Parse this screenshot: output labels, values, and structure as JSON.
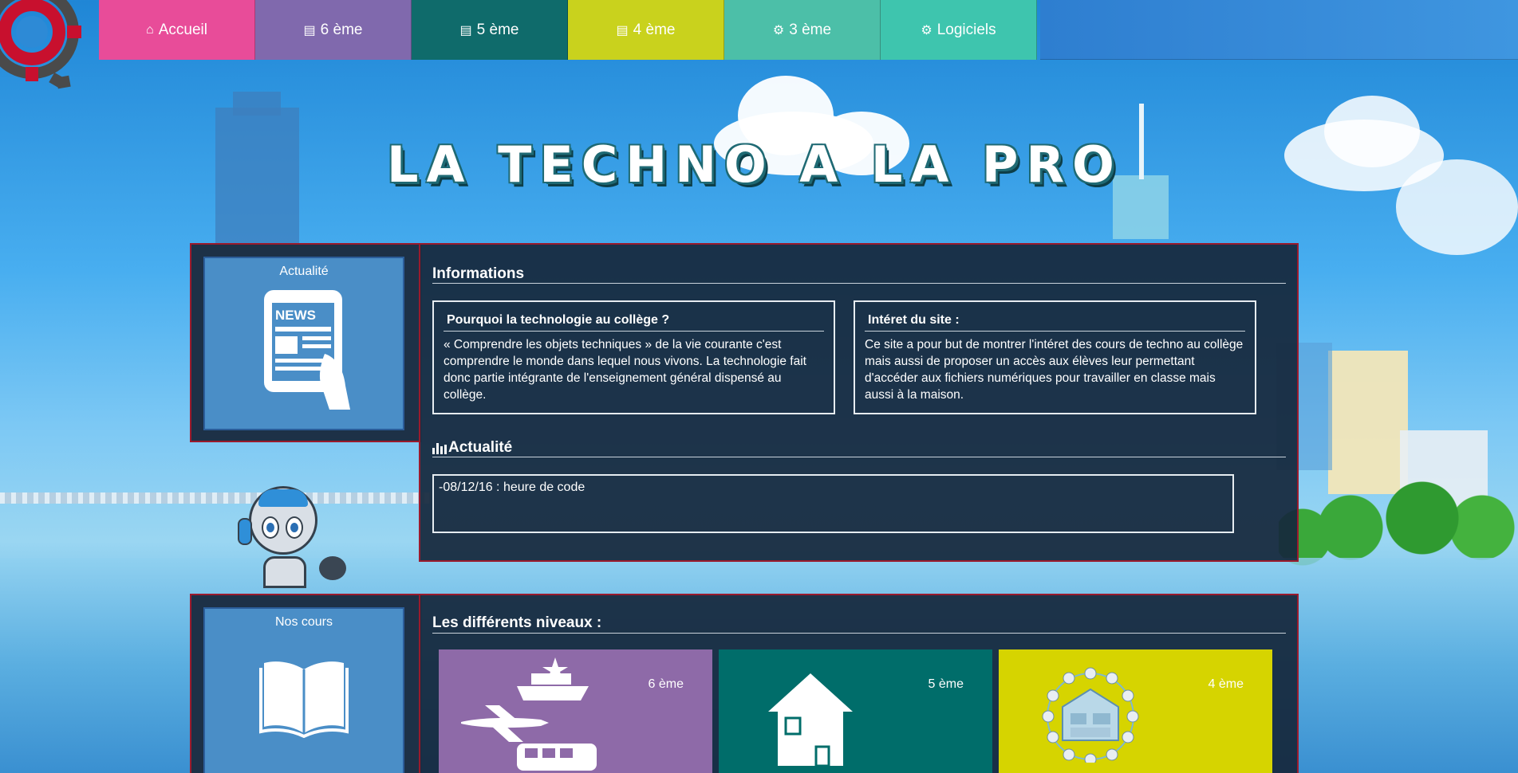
{
  "site": {
    "title": "La Techno a la pro",
    "accent_colors": {
      "accueil": "#e84c99",
      "sixieme": "#8069ad",
      "cinquieme": "#0f6b6b",
      "quatrieme": "#c9d21d",
      "troisieme": "#4cbfa8",
      "logiciels": "#3ec5ae"
    }
  },
  "nav": {
    "items": [
      {
        "label": "Accueil",
        "icon": "home-icon"
      },
      {
        "label": "6 ème",
        "icon": "book-icon"
      },
      {
        "label": "5 ème",
        "icon": "book-icon"
      },
      {
        "label": "4 ème",
        "icon": "book-icon"
      },
      {
        "label": "3 ème",
        "icon": "gears-icon"
      },
      {
        "label": "Logiciels",
        "icon": "gears-icon"
      }
    ]
  },
  "actualite_tile": {
    "label": "Actualité",
    "icon": "news-tablet-icon"
  },
  "informations": {
    "title": "Informations",
    "cards": [
      {
        "title": "Pourquoi la technologie au collège ?",
        "text": "« Comprendre les objets techniques » de la vie courante c'est comprendre le monde dans lequel nous vivons. La technologie fait donc partie intégrante de l'enseignement général dispensé au collège."
      },
      {
        "title": "Intéret du site :",
        "text": "Ce site a pour but de montrer l'intéret des cours de techno au collège mais aussi de proposer un accès aux élèves leur permettant d'accéder aux fichiers numériques pour travailler en classe mais aussi à la maison."
      }
    ]
  },
  "actualite_section": {
    "title": "Actualité",
    "icon": "bar-chart-icon",
    "items": [
      "-08/12/16 : heure de code"
    ]
  },
  "cours_tile": {
    "label": "Nos cours",
    "icon": "open-book-icon"
  },
  "niveaux": {
    "title": "Les différents niveaux :",
    "tiles": [
      {
        "label": "6 ème",
        "icon": "transport-icon",
        "color": "#8e6aa8"
      },
      {
        "label": "5 ème",
        "icon": "house-icon",
        "color": "#006d6a"
      },
      {
        "label": "4 ème",
        "icon": "smart-home-icon",
        "color": "#d6d400"
      }
    ]
  }
}
